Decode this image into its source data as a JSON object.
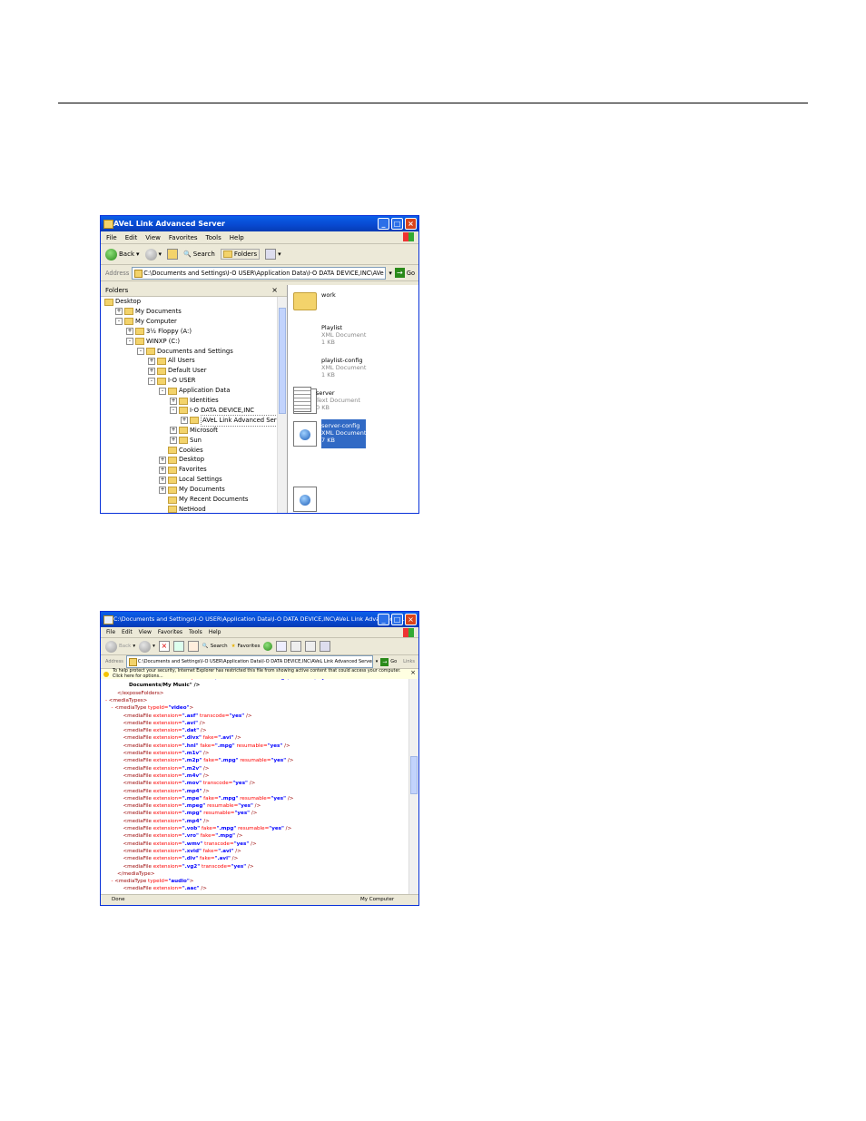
{
  "window1": {
    "title": "AVeL Link Advanced Server",
    "menu": [
      "File",
      "Edit",
      "View",
      "Favorites",
      "Tools",
      "Help"
    ],
    "toolbar": {
      "back": "Back",
      "search": "Search",
      "folders": "Folders"
    },
    "address": {
      "label": "Address",
      "path": "C:\\Documents and Settings\\I-O USER\\Application Data\\I-O DATA DEVICE,INC\\AVe",
      "go": "Go"
    },
    "folders_pane": {
      "header": "Folders",
      "tree": [
        {
          "label": "Desktop",
          "depth": 0,
          "expander": ""
        },
        {
          "label": "My Documents",
          "depth": 1,
          "expander": "+"
        },
        {
          "label": "My Computer",
          "depth": 1,
          "expander": "-"
        },
        {
          "label": "3½ Floppy (A:)",
          "depth": 2,
          "expander": "+"
        },
        {
          "label": "WINXP (C:)",
          "depth": 2,
          "expander": "-"
        },
        {
          "label": "Documents and Settings",
          "depth": 3,
          "expander": "-"
        },
        {
          "label": "All Users",
          "depth": 4,
          "expander": "+"
        },
        {
          "label": "Default User",
          "depth": 4,
          "expander": "+"
        },
        {
          "label": "I-O USER",
          "depth": 4,
          "expander": "-"
        },
        {
          "label": "Application Data",
          "depth": 5,
          "expander": "-"
        },
        {
          "label": "Identities",
          "depth": 6,
          "expander": "+"
        },
        {
          "label": "I-O DATA DEVICE,INC",
          "depth": 6,
          "expander": "-"
        },
        {
          "label": "AVeL Link Advanced Server",
          "depth": 7,
          "expander": "+"
        },
        {
          "label": "Microsoft",
          "depth": 6,
          "expander": "+"
        },
        {
          "label": "Sun",
          "depth": 6,
          "expander": "+"
        },
        {
          "label": "Cookies",
          "depth": 5,
          "expander": ""
        },
        {
          "label": "Desktop",
          "depth": 5,
          "expander": "+"
        },
        {
          "label": "Favorites",
          "depth": 5,
          "expander": "+"
        },
        {
          "label": "Local Settings",
          "depth": 5,
          "expander": "+"
        },
        {
          "label": "My Documents",
          "depth": 5,
          "expander": "+"
        },
        {
          "label": "My Recent Documents",
          "depth": 5,
          "expander": ""
        },
        {
          "label": "NetHood",
          "depth": 5,
          "expander": ""
        }
      ]
    },
    "files": [
      {
        "name": "work",
        "type": "",
        "size": "",
        "icon": "folder-icon",
        "selected": false
      },
      {
        "name": "Playlist",
        "type": "XML Document",
        "size": "1 KB",
        "icon": "xml-document-icon",
        "selected": false
      },
      {
        "name": "playlist-config",
        "type": "XML Document",
        "size": "1 KB",
        "icon": "xml-document-icon",
        "selected": false
      },
      {
        "name": "server",
        "type": "Text Document",
        "size": "0 KB",
        "icon": "text-document-icon",
        "selected": false
      },
      {
        "name": "server-config",
        "type": "XML Document",
        "size": "7 KB",
        "icon": "xml-document-icon",
        "selected": true
      }
    ]
  },
  "window2": {
    "title": "C:\\Documents and Settings\\I-O USER\\Application Data\\I-O DATA DEVICE,INC\\AVeL Link Advanced S...",
    "menu": [
      "File",
      "Edit",
      "View",
      "Favorites",
      "Tools",
      "Help"
    ],
    "toolbar": {
      "back": "Back",
      "search": "Search",
      "favorites": "Favorites"
    },
    "address": {
      "label": "Address",
      "path": "C:\\Documents and Settings\\I-O USER\\Application Data\\I-O DATA DEVICE,INC\\AVeL Link Advanced Server\\",
      "go": "Go",
      "links": "Links"
    },
    "infobar": "To help protect your security, Internet Explorer has restricted this file from showing active content that could access your computer. Click here for options...",
    "xml_lines": [
      {
        "indent": 3,
        "dash": false,
        "tag": "<folder",
        "attrs": [
          [
            "mediaId",
            "audio"
          ],
          [
            "path",
            "C:/Documents and Settings/I-O USER/My"
          ]
        ],
        "close": "",
        "text": ""
      },
      {
        "indent": 4,
        "dash": false,
        "tag": "",
        "attrs": [],
        "close": "",
        "text": "Documents/My Music\" />"
      },
      {
        "indent": 2,
        "dash": false,
        "tag": "</exposeFolders>",
        "attrs": [],
        "close": "",
        "text": ""
      },
      {
        "indent": 0,
        "dash": true,
        "tag": "<mediaTypes>",
        "attrs": [],
        "close": "",
        "text": ""
      },
      {
        "indent": 1,
        "dash": true,
        "tag": "<mediaType",
        "attrs": [
          [
            "typeId",
            "video"
          ]
        ],
        "close": ">",
        "text": ""
      },
      {
        "indent": 3,
        "dash": false,
        "tag": "<mediaFile",
        "attrs": [
          [
            "extension",
            ".asf"
          ],
          [
            "transcode",
            "yes"
          ]
        ],
        "close": " />",
        "text": ""
      },
      {
        "indent": 3,
        "dash": false,
        "tag": "<mediaFile",
        "attrs": [
          [
            "extension",
            ".avi"
          ]
        ],
        "close": " />",
        "text": ""
      },
      {
        "indent": 3,
        "dash": false,
        "tag": "<mediaFile",
        "attrs": [
          [
            "extension",
            ".dat"
          ]
        ],
        "close": " />",
        "text": ""
      },
      {
        "indent": 3,
        "dash": false,
        "tag": "<mediaFile",
        "attrs": [
          [
            "extension",
            ".divx"
          ],
          [
            "fake",
            ".avi"
          ]
        ],
        "close": " />",
        "text": ""
      },
      {
        "indent": 3,
        "dash": false,
        "tag": "<mediaFile",
        "attrs": [
          [
            "extension",
            ".hnl"
          ],
          [
            "fake",
            ".mpg"
          ],
          [
            "resumable",
            "yes"
          ]
        ],
        "close": " />",
        "text": ""
      },
      {
        "indent": 3,
        "dash": false,
        "tag": "<mediaFile",
        "attrs": [
          [
            "extension",
            ".m1v"
          ]
        ],
        "close": " />",
        "text": ""
      },
      {
        "indent": 3,
        "dash": false,
        "tag": "<mediaFile",
        "attrs": [
          [
            "extension",
            ".m2p"
          ],
          [
            "fake",
            ".mpg"
          ],
          [
            "resumable",
            "yes"
          ]
        ],
        "close": " />",
        "text": ""
      },
      {
        "indent": 3,
        "dash": false,
        "tag": "<mediaFile",
        "attrs": [
          [
            "extension",
            ".m2v"
          ]
        ],
        "close": " />",
        "text": ""
      },
      {
        "indent": 3,
        "dash": false,
        "tag": "<mediaFile",
        "attrs": [
          [
            "extension",
            ".m4v"
          ]
        ],
        "close": " />",
        "text": ""
      },
      {
        "indent": 3,
        "dash": false,
        "tag": "<mediaFile",
        "attrs": [
          [
            "extension",
            ".mov"
          ],
          [
            "transcode",
            "yes"
          ]
        ],
        "close": " />",
        "text": ""
      },
      {
        "indent": 3,
        "dash": false,
        "tag": "<mediaFile",
        "attrs": [
          [
            "extension",
            ".mp4"
          ]
        ],
        "close": " />",
        "text": ""
      },
      {
        "indent": 3,
        "dash": false,
        "tag": "<mediaFile",
        "attrs": [
          [
            "extension",
            ".mpe"
          ],
          [
            "fake",
            ".mpg"
          ],
          [
            "resumable",
            "yes"
          ]
        ],
        "close": " />",
        "text": ""
      },
      {
        "indent": 3,
        "dash": false,
        "tag": "<mediaFile",
        "attrs": [
          [
            "extension",
            ".mpeg"
          ],
          [
            "resumable",
            "yes"
          ]
        ],
        "close": " />",
        "text": ""
      },
      {
        "indent": 3,
        "dash": false,
        "tag": "<mediaFile",
        "attrs": [
          [
            "extension",
            ".mpg"
          ],
          [
            "resumable",
            "yes"
          ]
        ],
        "close": " />",
        "text": ""
      },
      {
        "indent": 3,
        "dash": false,
        "tag": "<mediaFile",
        "attrs": [
          [
            "extension",
            ".mp4"
          ]
        ],
        "close": " />",
        "text": ""
      },
      {
        "indent": 3,
        "dash": false,
        "tag": "<mediaFile",
        "attrs": [
          [
            "extension",
            ".vob"
          ],
          [
            "fake",
            ".mpg"
          ],
          [
            "resumable",
            "yes"
          ]
        ],
        "close": " />",
        "text": ""
      },
      {
        "indent": 3,
        "dash": false,
        "tag": "<mediaFile",
        "attrs": [
          [
            "extension",
            ".vro"
          ],
          [
            "fake",
            ".mpg"
          ]
        ],
        "close": " />",
        "text": ""
      },
      {
        "indent": 3,
        "dash": false,
        "tag": "<mediaFile",
        "attrs": [
          [
            "extension",
            ".wmv"
          ],
          [
            "transcode",
            "yes"
          ]
        ],
        "close": " />",
        "text": ""
      },
      {
        "indent": 3,
        "dash": false,
        "tag": "<mediaFile",
        "attrs": [
          [
            "extension",
            ".xvid"
          ],
          [
            "fake",
            ".avi"
          ]
        ],
        "close": " />",
        "text": ""
      },
      {
        "indent": 3,
        "dash": false,
        "tag": "<mediaFile",
        "attrs": [
          [
            "extension",
            ".div"
          ],
          [
            "fake",
            ".avi"
          ]
        ],
        "close": " />",
        "text": ""
      },
      {
        "indent": 3,
        "dash": false,
        "tag": "<mediaFile",
        "attrs": [
          [
            "extension",
            ".vg2"
          ],
          [
            "transcode",
            "yes"
          ]
        ],
        "close": " />",
        "text": ""
      },
      {
        "indent": 2,
        "dash": false,
        "tag": "</mediaType>",
        "attrs": [],
        "close": "",
        "text": ""
      },
      {
        "indent": 1,
        "dash": true,
        "tag": "<mediaType",
        "attrs": [
          [
            "typeId",
            "audio"
          ]
        ],
        "close": ">",
        "text": ""
      },
      {
        "indent": 3,
        "dash": false,
        "tag": "<mediaFile",
        "attrs": [
          [
            "extension",
            ".aac"
          ]
        ],
        "close": " />",
        "text": ""
      }
    ],
    "status": {
      "left": "Done",
      "right": "My Computer"
    }
  }
}
